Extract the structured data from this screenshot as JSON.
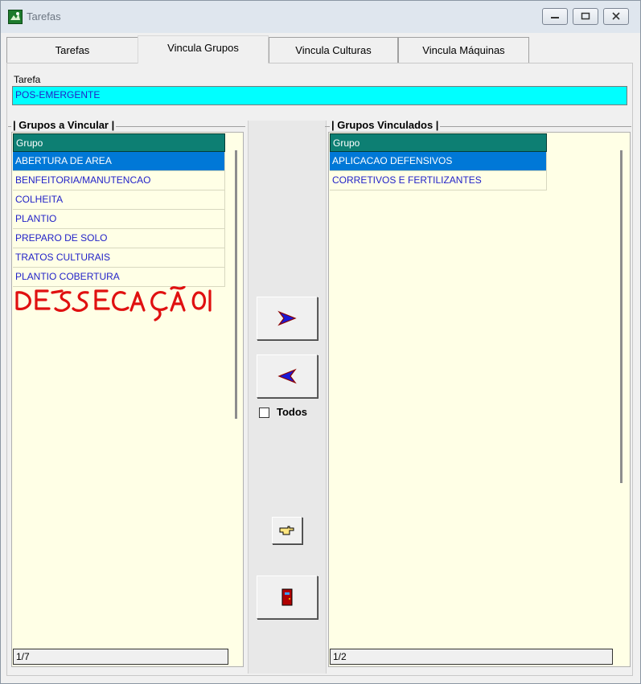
{
  "window": {
    "title": "Tarefas",
    "accent": "#0078d7"
  },
  "tabs": [
    {
      "label": "Tarefas",
      "active": false
    },
    {
      "label": "Vincula Grupos",
      "active": true
    },
    {
      "label": "Vincula Culturas",
      "active": false
    },
    {
      "label": "Vincula Máquinas",
      "active": false
    }
  ],
  "tarefa": {
    "label": "Tarefa",
    "value": "POS-EMERGENTE",
    "field_color": "#00ffff"
  },
  "left_group": {
    "title": "| Grupos a Vincular |",
    "header": "Grupo",
    "items": [
      {
        "label": "ABERTURA DE AREA",
        "selected": true
      },
      {
        "label": "BENFEITORIA/MANUTENCAO",
        "selected": false
      },
      {
        "label": "COLHEITA",
        "selected": false
      },
      {
        "label": "PLANTIO",
        "selected": false
      },
      {
        "label": "PREPARO DE SOLO",
        "selected": false
      },
      {
        "label": "TRATOS CULTURAIS",
        "selected": false
      },
      {
        "label": "PLANTIO COBERTURA",
        "selected": false
      }
    ],
    "counter": "1/7"
  },
  "right_group": {
    "title": "| Grupos Vinculados |",
    "header": "Grupo",
    "items": [
      {
        "label": "APLICACAO DEFENSIVOS",
        "selected": true
      },
      {
        "label": "CORRETIVOS E FERTILIZANTES",
        "selected": false
      }
    ],
    "counter": "1/2"
  },
  "middle": {
    "todos_label": "Todos",
    "todos_checked": false,
    "buttons": [
      "arrow-right-icon",
      "arrow-left-icon",
      "pointing-hand-icon",
      "exit-door-icon"
    ]
  },
  "annotation": {
    "handwritten_text": "DESSECAÇÃO",
    "color": "#e01010"
  }
}
